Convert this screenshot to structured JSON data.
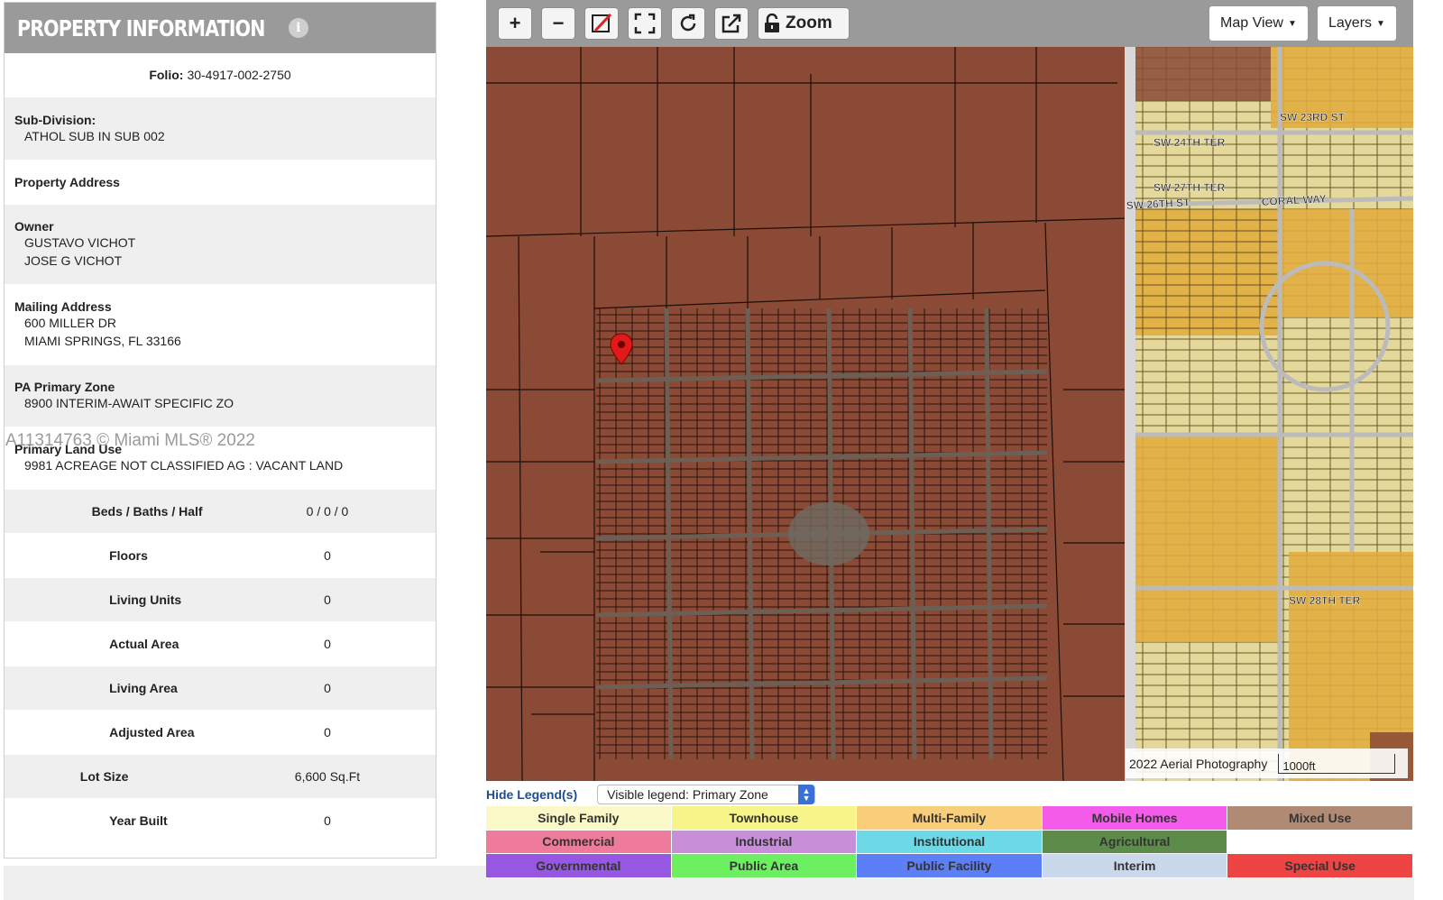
{
  "panel": {
    "title": "PROPERTY INFORMATION",
    "info_glyph": "i",
    "folio": {
      "label": "Folio:",
      "value": "30-4917-002-2750"
    },
    "subdivision": {
      "label": "Sub-Division:",
      "value": "ATHOL SUB IN SUB 002"
    },
    "property_address": {
      "label": "Property Address"
    },
    "owner": {
      "label": "Owner",
      "lines": [
        "GUSTAVO VICHOT",
        "JOSE G VICHOT"
      ]
    },
    "mailing": {
      "label": "Mailing Address",
      "lines": [
        "600 MILLER DR",
        "MIAMI SPRINGS, FL 33166"
      ]
    },
    "primary_zone": {
      "label": "PA Primary Zone",
      "value": "8900 INTERIM-AWAIT SPECIFIC ZO"
    },
    "land_use": {
      "label": "Primary Land Use",
      "value": "9981 ACREAGE NOT CLASSIFIED AG : VACANT LAND"
    },
    "details": [
      {
        "label": "Beds / Baths / Half",
        "value": "0 / 0 / 0"
      },
      {
        "label": "Floors",
        "value": "0"
      },
      {
        "label": "Living Units",
        "value": "0"
      },
      {
        "label": "Actual Area",
        "value": "0"
      },
      {
        "label": "Living Area",
        "value": "0"
      },
      {
        "label": "Adjusted Area",
        "value": "0"
      },
      {
        "label": "Lot Size",
        "value": "6,600 Sq.Ft"
      },
      {
        "label": "Year Built",
        "value": "0"
      }
    ]
  },
  "watermark": "A11314763 © Miami MLS® 2022",
  "toolbar": {
    "zoom_in": "+",
    "zoom_out": "−",
    "zoom_label": "Zoom",
    "map_view": "Map View",
    "layers": "Layers"
  },
  "map": {
    "streets": [
      "SW 26TH ST",
      "CORAL WAY",
      "SW 23RD ST",
      "SW 24TH TER",
      "SW 27TH TER",
      "SW 28TH TER"
    ],
    "aerial_label": "2022 Aerial Photography",
    "scale_label": "1000ft",
    "colors": {
      "agricultural": "#8a4a35",
      "residential": "#e4d89a",
      "commercial": "#e1ad3e"
    }
  },
  "legend": {
    "hide_label": "Hide Legend(s)",
    "visible_label": "Visible legend: Primary Zone",
    "items": [
      {
        "name": "Single Family",
        "color": "#fbf8c8"
      },
      {
        "name": "Townhouse",
        "color": "#f7f48a"
      },
      {
        "name": "Multi-Family",
        "color": "#f8ce7a"
      },
      {
        "name": "Mobile Homes",
        "color": "#f25ce9"
      },
      {
        "name": "Mixed Use",
        "color": "#b18a74"
      },
      {
        "name": "Commercial",
        "color": "#ee7b9b"
      },
      {
        "name": "Industrial",
        "color": "#c68fd8"
      },
      {
        "name": "Institutional",
        "color": "#6dd9e6"
      },
      {
        "name": "Agricultural",
        "color": "#5d8c4a"
      },
      {
        "name": "",
        "color": "#ffffff"
      },
      {
        "name": "Governmental",
        "color": "#9658e3"
      },
      {
        "name": "Public Area",
        "color": "#6cf061"
      },
      {
        "name": "Public Facility",
        "color": "#5d7ff5"
      },
      {
        "name": "Interim",
        "color": "#c9d8ea"
      },
      {
        "name": "Special Use",
        "color": "#ef4444"
      }
    ]
  }
}
